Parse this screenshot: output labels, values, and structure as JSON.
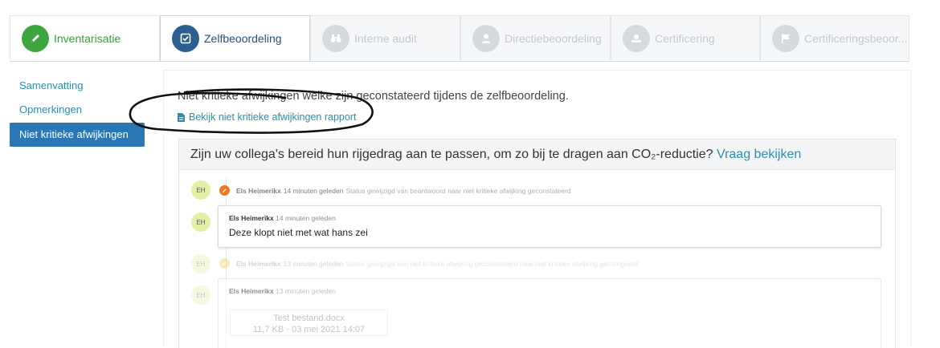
{
  "steps": [
    {
      "label": "Inventarisatie",
      "state": "done",
      "icon": "pencil-icon"
    },
    {
      "label": "Zelfbeoordeling",
      "state": "active",
      "icon": "checkbox-icon"
    },
    {
      "label": "Interne audit",
      "state": "disabled",
      "icon": "binoculars-icon"
    },
    {
      "label": "Directiebeoordeling",
      "state": "disabled",
      "icon": "user-icon"
    },
    {
      "label": "Certificering",
      "state": "disabled",
      "icon": "certificate-icon"
    },
    {
      "label": "Certificeringsbeoor...",
      "state": "disabled",
      "icon": "flag-icon"
    }
  ],
  "sidebar": {
    "items": [
      {
        "label": "Samenvatting",
        "active": false
      },
      {
        "label": "Opmerkingen",
        "active": false
      },
      {
        "label": "Niet kritieke afwijkingen",
        "active": true
      }
    ]
  },
  "main": {
    "intro": "Niet kritieke afwijkingen welke zijn geconstateerd tijdens de zelfbeoordeling.",
    "report_link": "Bekijk niet kritieke afwijkingen rapport"
  },
  "question": {
    "text": "Zijn uw collega's bereid hun rijgedrag aan te passen, om zo bij te dragen aan CO₂-reductie?",
    "link": "Vraag bekijken"
  },
  "timeline": {
    "initials": "EH",
    "entry1": {
      "author": "Els Heimerikx",
      "time": "14 minuten geleden",
      "message": "Status gewijzigd van beantwoord naar niet kritieke afwijking geconstateerd"
    },
    "entry2": {
      "author": "Els Heimerikx",
      "time": "14 minuten geleden",
      "text": "Deze klopt niet met wat hans zei"
    },
    "entry3": {
      "author": "Els Heimerikx",
      "time": "13 minuten geleden",
      "message": "Status gewijzigd van niet kritieke afwijking geconstateerd naar niet kritieke afwijking gecorrigeerd"
    },
    "entry4": {
      "author": "Els Heimerikx",
      "time": "13 minuten geleden",
      "file": {
        "name": "Test bestand.docx",
        "info": "11,7 KB · 03 mei 2021 14:07"
      }
    }
  },
  "colors": {
    "accent": "#2a8fb0",
    "active_nav": "#2a77b5",
    "done_green": "#3ea43e",
    "active_step": "#2c5f8f"
  }
}
